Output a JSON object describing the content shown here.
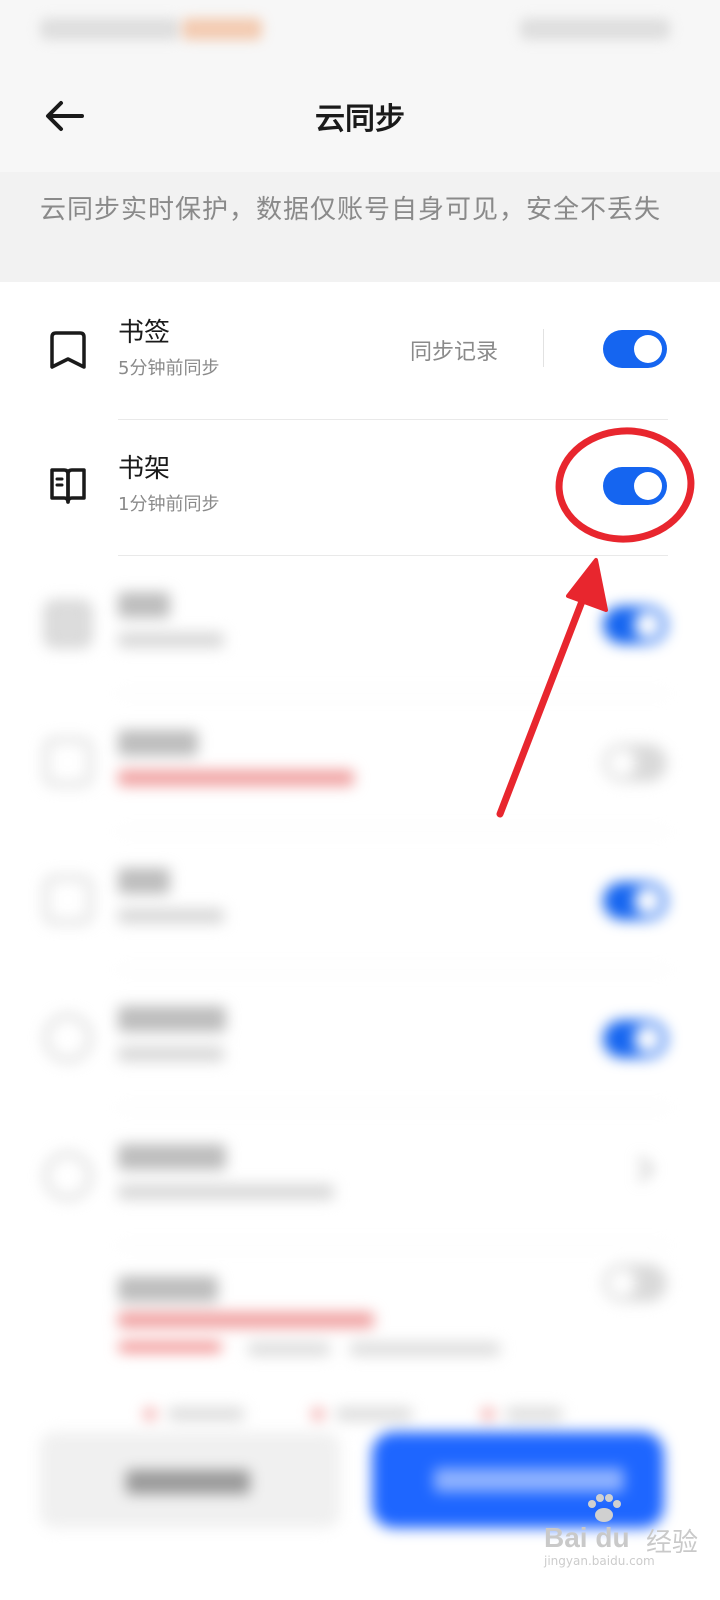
{
  "header": {
    "title": "云同步",
    "back_icon": "arrow-left-icon"
  },
  "notice": {
    "text": "云同步实时保护，数据仅账号自身可见，安全不丢失"
  },
  "items": [
    {
      "title": "书签",
      "subtitle": "5分钟前同步",
      "icon": "bookmark-icon",
      "action_label": "同步记录",
      "enabled": true
    },
    {
      "title": "书架",
      "subtitle": "1分钟前同步",
      "icon": "open-book-icon",
      "enabled": true
    }
  ],
  "colors": {
    "accent": "#1565f0",
    "annotation": "#e8262e"
  },
  "watermark": {
    "brand": "Bai du",
    "brand_cn": "经验",
    "url": "jingyan.baidu.com"
  }
}
